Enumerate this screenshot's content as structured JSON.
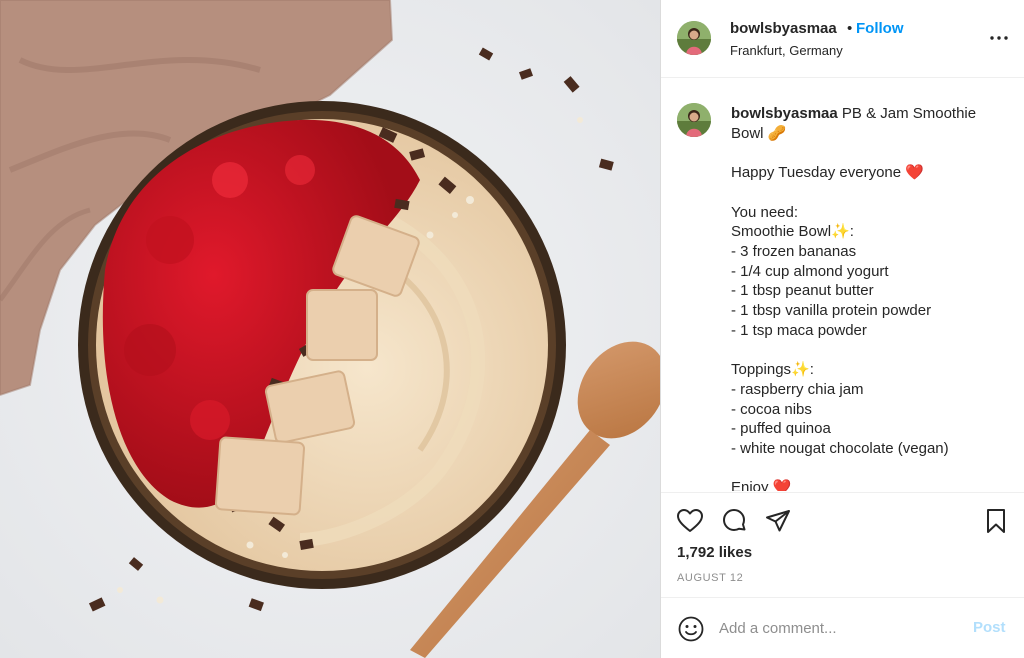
{
  "photo": {
    "description_icon": "smoothie-bowl-photo"
  },
  "header": {
    "username": "bowlsbyasmaa",
    "separator": "•",
    "follow_label": "Follow",
    "location": "Frankfurt, Germany",
    "more_icon": "more-dots-icon"
  },
  "caption": {
    "username": "bowlsbyasmaa",
    "text": " PB & Jam Smoothie Bowl 🥜\n\nHappy Tuesday everyone ❤️\n\nYou need:\nSmoothie Bowl✨:\n- 3 frozen bananas\n- 1/4 cup almond yogurt\n- 1 tbsp peanut butter\n- 1 tbsp vanilla protein powder\n- 1 tsp maca powder\n\nToppings✨:\n- raspberry chia jam\n- cocoa nibs\n- puffed quinoa\n- white nougat chocolate (vegan)\n\nEnjoy ❤️"
  },
  "actions": {
    "likes": "1,792 likes",
    "date": "AUGUST 12"
  },
  "comment_bar": {
    "placeholder": "Add a comment...",
    "post_label": "Post"
  },
  "colors": {
    "link_blue": "#0095f6",
    "post_disabled": "#b2dffc",
    "muted_text": "#8e8e8e"
  }
}
